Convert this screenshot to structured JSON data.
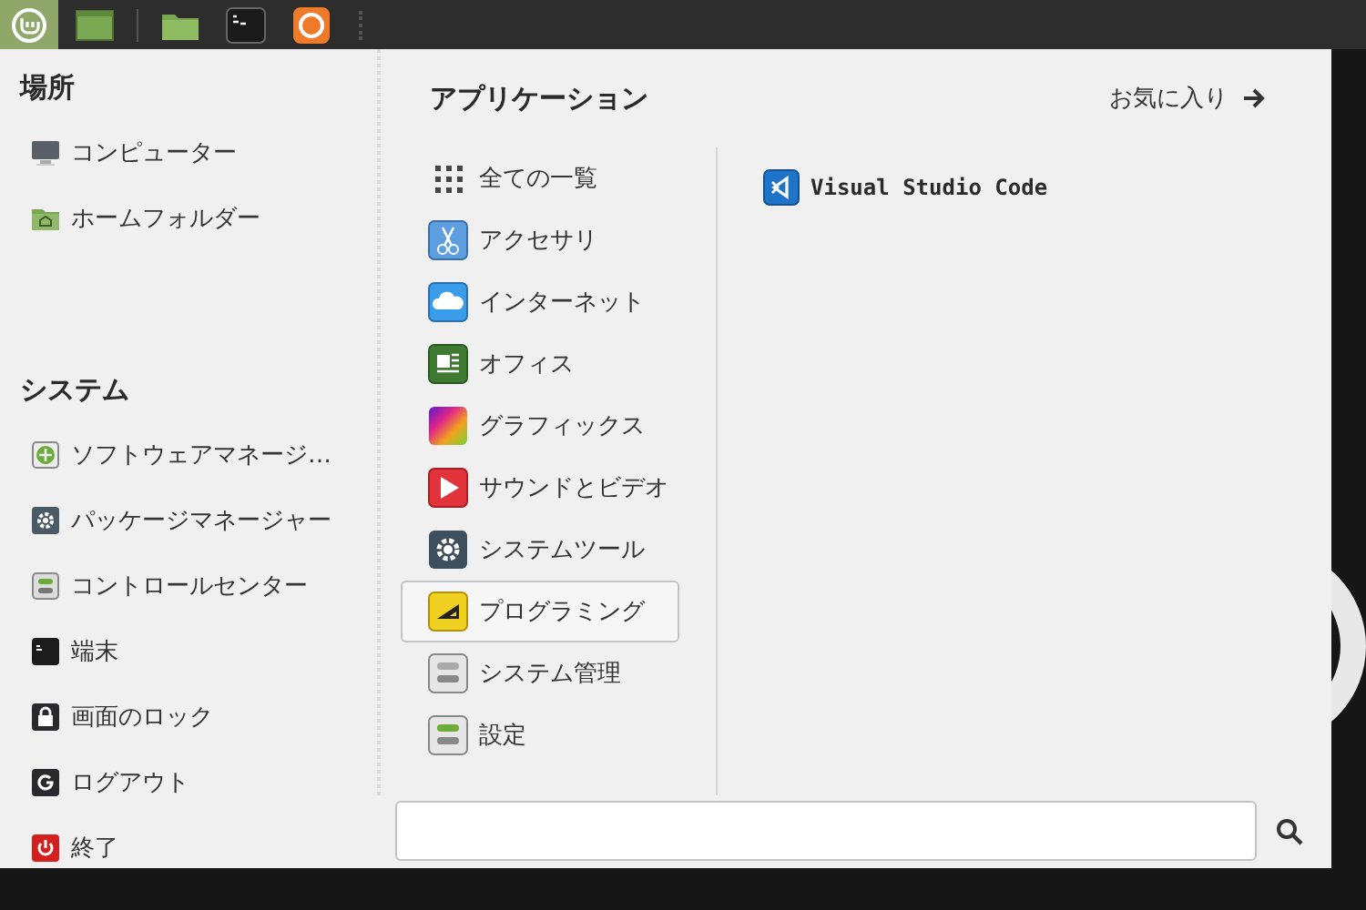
{
  "panel": {
    "menu_button": {
      "active": true
    }
  },
  "places": {
    "title": "場所",
    "items": [
      {
        "label": "コンピューター"
      },
      {
        "label": "ホームフォルダー"
      }
    ]
  },
  "system": {
    "title": "システム",
    "items": [
      {
        "label": "ソフトウェアマネージ…"
      },
      {
        "label": "パッケージマネージャー"
      },
      {
        "label": "コントロールセンター"
      },
      {
        "label": "端末"
      },
      {
        "label": "画面のロック"
      },
      {
        "label": "ログアウト"
      },
      {
        "label": "終了"
      }
    ]
  },
  "applications": {
    "title": "アプリケーション",
    "favorites_link": "お気に入り",
    "categories": [
      {
        "label": "全ての一覧",
        "selected": false
      },
      {
        "label": "アクセサリ",
        "selected": false
      },
      {
        "label": "インターネット",
        "selected": false
      },
      {
        "label": "オフィス",
        "selected": false
      },
      {
        "label": "グラフィックス",
        "selected": false
      },
      {
        "label": "サウンドとビデオ",
        "selected": false
      },
      {
        "label": "システムツール",
        "selected": false
      },
      {
        "label": "プログラミング",
        "selected": true
      },
      {
        "label": "システム管理",
        "selected": false
      },
      {
        "label": "設定",
        "selected": false
      }
    ],
    "apps": [
      {
        "label": "Visual Studio Code"
      }
    ]
  }
}
